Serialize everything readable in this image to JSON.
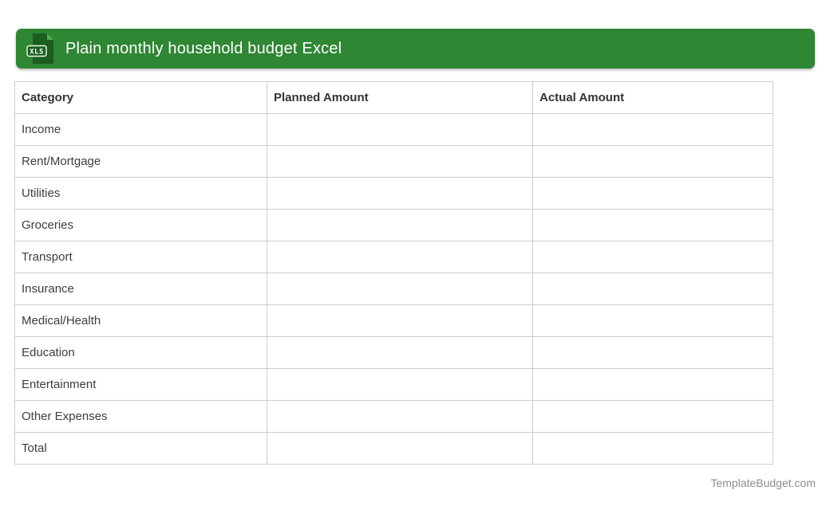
{
  "header": {
    "title": "Plain monthly household budget Excel",
    "icon_label": "XLS",
    "bar_color": "#2f8633",
    "icon_color": "#1b5e20",
    "title_color": "#ffffff"
  },
  "table": {
    "headers": [
      "Category",
      "Planned Amount",
      "Actual Amount"
    ],
    "rows": [
      {
        "category": "Income",
        "planned": "",
        "actual": ""
      },
      {
        "category": "Rent/Mortgage",
        "planned": "",
        "actual": ""
      },
      {
        "category": "Utilities",
        "planned": "",
        "actual": ""
      },
      {
        "category": "Groceries",
        "planned": "",
        "actual": ""
      },
      {
        "category": "Transport",
        "planned": "",
        "actual": ""
      },
      {
        "category": "Insurance",
        "planned": "",
        "actual": ""
      },
      {
        "category": "Medical/Health",
        "planned": "",
        "actual": ""
      },
      {
        "category": "Education",
        "planned": "",
        "actual": ""
      },
      {
        "category": "Entertainment",
        "planned": "",
        "actual": ""
      },
      {
        "category": "Other Expenses",
        "planned": "",
        "actual": ""
      },
      {
        "category": "Total",
        "planned": "",
        "actual": ""
      }
    ],
    "border_color": "#cccccc",
    "header_text_color": "#333333",
    "row_text_color": "#3d3d3d"
  },
  "footer": {
    "site": "TemplateBudget.com",
    "text_color": "#8d8d8d"
  }
}
